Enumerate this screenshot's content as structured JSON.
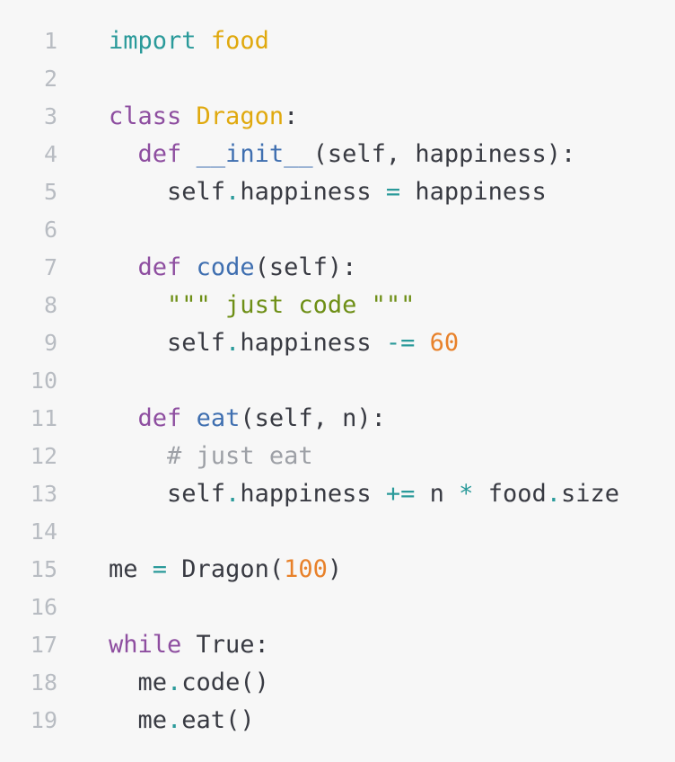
{
  "editor": {
    "lines": [
      {
        "no": "1",
        "tokens": [
          {
            "t": "import",
            "c": "kw2"
          },
          {
            "t": " ",
            "c": "plain"
          },
          {
            "t": "food",
            "c": "cls"
          }
        ]
      },
      {
        "no": "2",
        "tokens": []
      },
      {
        "no": "3",
        "tokens": [
          {
            "t": "class",
            "c": "kw"
          },
          {
            "t": " ",
            "c": "plain"
          },
          {
            "t": "Dragon",
            "c": "cls"
          },
          {
            "t": ":",
            "c": "plain"
          }
        ]
      },
      {
        "no": "4",
        "tokens": [
          {
            "t": "  ",
            "c": "plain"
          },
          {
            "t": "def",
            "c": "kw"
          },
          {
            "t": " ",
            "c": "plain"
          },
          {
            "t": "__init__",
            "c": "fn"
          },
          {
            "t": "(self, happiness):",
            "c": "plain"
          }
        ]
      },
      {
        "no": "5",
        "tokens": [
          {
            "t": "    self",
            "c": "plain"
          },
          {
            "t": ".",
            "c": "op"
          },
          {
            "t": "happiness ",
            "c": "plain"
          },
          {
            "t": "=",
            "c": "op"
          },
          {
            "t": " happiness",
            "c": "plain"
          }
        ]
      },
      {
        "no": "6",
        "tokens": []
      },
      {
        "no": "7",
        "tokens": [
          {
            "t": "  ",
            "c": "plain"
          },
          {
            "t": "def",
            "c": "kw"
          },
          {
            "t": " ",
            "c": "plain"
          },
          {
            "t": "code",
            "c": "fn"
          },
          {
            "t": "(self):",
            "c": "plain"
          }
        ]
      },
      {
        "no": "8",
        "tokens": [
          {
            "t": "    ",
            "c": "plain"
          },
          {
            "t": "\"\"\" just code \"\"\"",
            "c": "str"
          }
        ]
      },
      {
        "no": "9",
        "tokens": [
          {
            "t": "    self",
            "c": "plain"
          },
          {
            "t": ".",
            "c": "op"
          },
          {
            "t": "happiness ",
            "c": "plain"
          },
          {
            "t": "-=",
            "c": "op"
          },
          {
            "t": " ",
            "c": "plain"
          },
          {
            "t": "60",
            "c": "num"
          }
        ]
      },
      {
        "no": "10",
        "tokens": []
      },
      {
        "no": "11",
        "tokens": [
          {
            "t": "  ",
            "c": "plain"
          },
          {
            "t": "def",
            "c": "kw"
          },
          {
            "t": " ",
            "c": "plain"
          },
          {
            "t": "eat",
            "c": "fn"
          },
          {
            "t": "(self, n):",
            "c": "plain"
          }
        ]
      },
      {
        "no": "12",
        "tokens": [
          {
            "t": "    ",
            "c": "plain"
          },
          {
            "t": "# just eat",
            "c": "cm"
          }
        ]
      },
      {
        "no": "13",
        "tokens": [
          {
            "t": "    self",
            "c": "plain"
          },
          {
            "t": ".",
            "c": "op"
          },
          {
            "t": "happiness ",
            "c": "plain"
          },
          {
            "t": "+=",
            "c": "op"
          },
          {
            "t": " n ",
            "c": "plain"
          },
          {
            "t": "*",
            "c": "op"
          },
          {
            "t": " food",
            "c": "plain"
          },
          {
            "t": ".",
            "c": "op"
          },
          {
            "t": "size",
            "c": "plain"
          }
        ]
      },
      {
        "no": "14",
        "tokens": []
      },
      {
        "no": "15",
        "tokens": [
          {
            "t": "me ",
            "c": "plain"
          },
          {
            "t": "=",
            "c": "op"
          },
          {
            "t": " Dragon(",
            "c": "plain"
          },
          {
            "t": "100",
            "c": "num"
          },
          {
            "t": ")",
            "c": "plain"
          }
        ]
      },
      {
        "no": "16",
        "tokens": []
      },
      {
        "no": "17",
        "tokens": [
          {
            "t": "while",
            "c": "kw"
          },
          {
            "t": " True:",
            "c": "plain"
          }
        ]
      },
      {
        "no": "18",
        "tokens": [
          {
            "t": "  me",
            "c": "plain"
          },
          {
            "t": ".",
            "c": "op"
          },
          {
            "t": "code()",
            "c": "plain"
          }
        ]
      },
      {
        "no": "19",
        "tokens": [
          {
            "t": "  me",
            "c": "plain"
          },
          {
            "t": ".",
            "c": "op"
          },
          {
            "t": "eat()",
            "c": "plain"
          }
        ]
      }
    ]
  },
  "colors": {
    "background": "#f7f7f7",
    "line_number": "#b8bcc2",
    "keyword": "#8e4ea0",
    "import_keyword": "#2a9a9a",
    "class_name": "#e0a90e",
    "function_name": "#3f6fb0",
    "string": "#6e8f16",
    "number": "#e8812a",
    "operator": "#2a9a9a",
    "comment": "#9da0a6",
    "text": "#383a42"
  }
}
